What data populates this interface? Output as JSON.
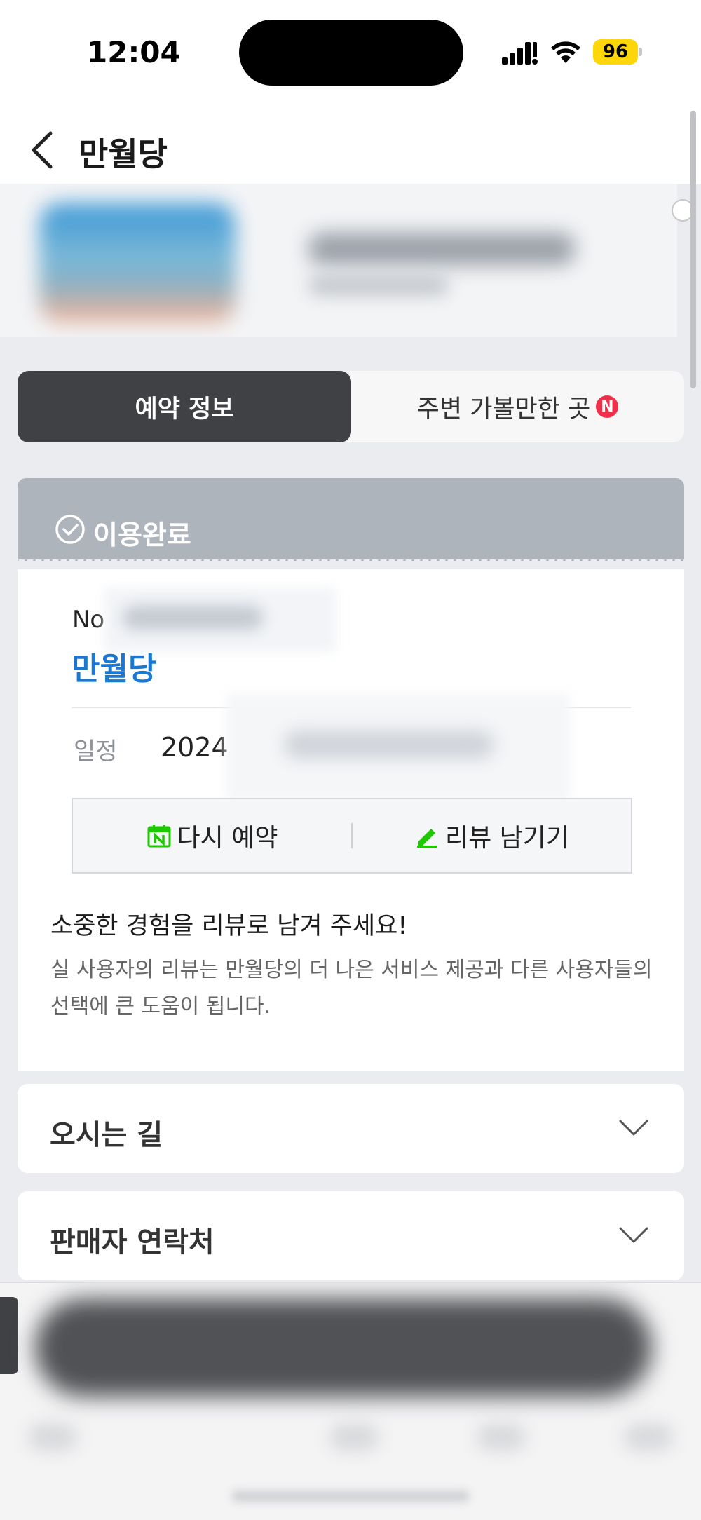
{
  "status_bar": {
    "time": "12:04",
    "battery": "96",
    "battery_color": "#ffd60a"
  },
  "header": {
    "title": "만월당",
    "back_icon": "chevron-left-icon"
  },
  "tabs": [
    {
      "label": "예약 정보",
      "active": true
    },
    {
      "label": "주변 가볼만한 곳",
      "badge": "N",
      "active": false
    }
  ],
  "booking": {
    "status": "이용완료",
    "status_icon": "check-circle-icon",
    "order_prefix": "No",
    "venue": "만월당",
    "date_label": "일정",
    "date_value": "2024",
    "actions": {
      "rebook_label": "다시 예약",
      "rebook_icon": "calendar-n-icon",
      "review_label": "리뷰 남기기",
      "review_icon": "pencil-icon"
    },
    "review_prompt": {
      "title": "소중한 경험을 리뷰로 남겨 주세요!",
      "desc": "실 사용자의 리뷰는 만월당의 더 나은 서비스 제공과 다른 사용자들의 선택에 큰 도움이 됩니다."
    }
  },
  "accordions": [
    {
      "title": "오시는 길",
      "icon": "chevron-down-icon"
    },
    {
      "title": "판매자 연락처",
      "icon": "chevron-down-icon"
    }
  ],
  "colors": {
    "accent_link": "#1a78d2",
    "tab_active_bg": "#404145",
    "status_banner_bg": "#aeb4bb",
    "badge_red": "#f0304a",
    "green_icon": "#1ec800"
  }
}
